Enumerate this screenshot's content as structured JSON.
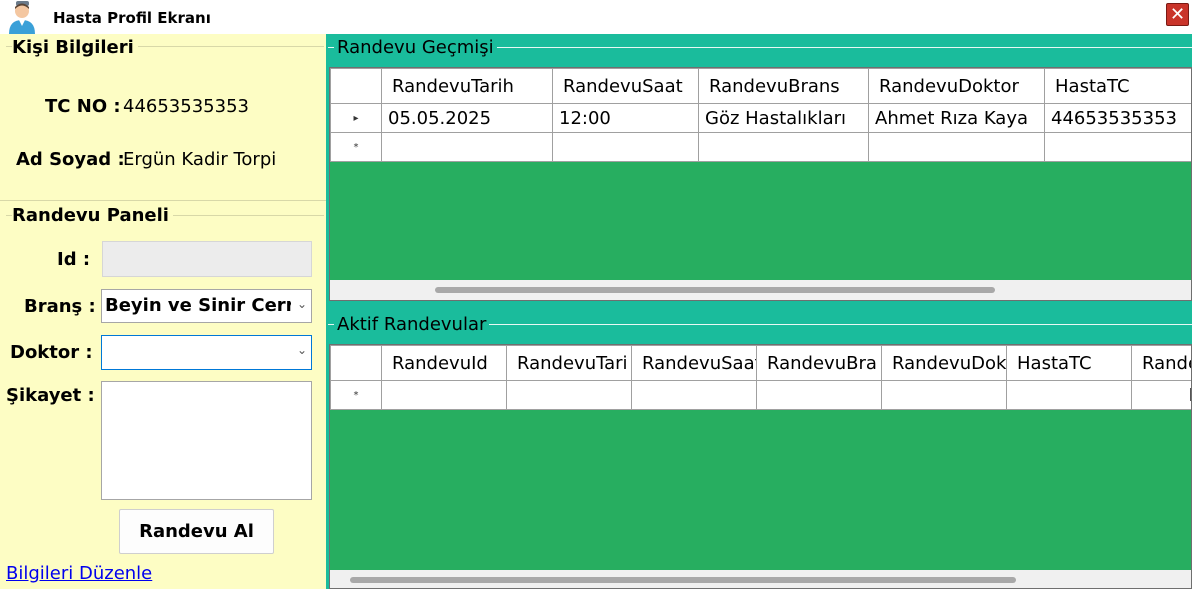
{
  "window": {
    "title": "Hasta Profil Ekranı",
    "close_glyph": "✕"
  },
  "person_info": {
    "group_title": "Kişi Bilgileri",
    "tc_label": "TC NO :",
    "tc_value": "44653535353",
    "name_label": "Ad Soyad :",
    "name_value": "Ergün Kadir Torpi"
  },
  "appointment_panel": {
    "group_title": "Randevu Paneli",
    "id_label": "Id :",
    "id_value": "",
    "branch_label": "Branş :",
    "branch_value": "Beyin ve Sinir Cerra",
    "doctor_label": "Doktor :",
    "doctor_value": "",
    "complaint_label": "Şikayet :",
    "complaint_value": "",
    "submit_label": "Randevu Al"
  },
  "edit_link": "Bilgileri Düzenle",
  "history": {
    "group_title": "Randevu Geçmişi",
    "columns": [
      "RandevuTarih",
      "RandevuSaat",
      "RandevuBrans",
      "RandevuDoktor",
      "HastaTC"
    ],
    "rows": [
      {
        "marker": "▸",
        "cells": [
          "05.05.2025",
          "12:00",
          "Göz Hastalıkları",
          "Ahmet Rıza Kaya",
          "44653535353"
        ]
      }
    ],
    "new_row_marker": "*"
  },
  "active": {
    "group_title": "Aktif Randevular",
    "columns": [
      "RandevuId",
      "RandevuTari",
      "RandevuSaat",
      "RandevuBra",
      "RandevuDok",
      "HastaTC",
      "Rande"
    ],
    "new_row_marker": "*"
  },
  "colors": {
    "left_bg": "#fdfdc4",
    "right_bg": "#1abc9c",
    "grid_bg": "#27ae60",
    "link": "#0000ee",
    "close_button": "#c9342a"
  },
  "icons": {
    "app": "user-avatar-icon",
    "close": "close-icon",
    "chevron": "chevron-down-icon"
  }
}
